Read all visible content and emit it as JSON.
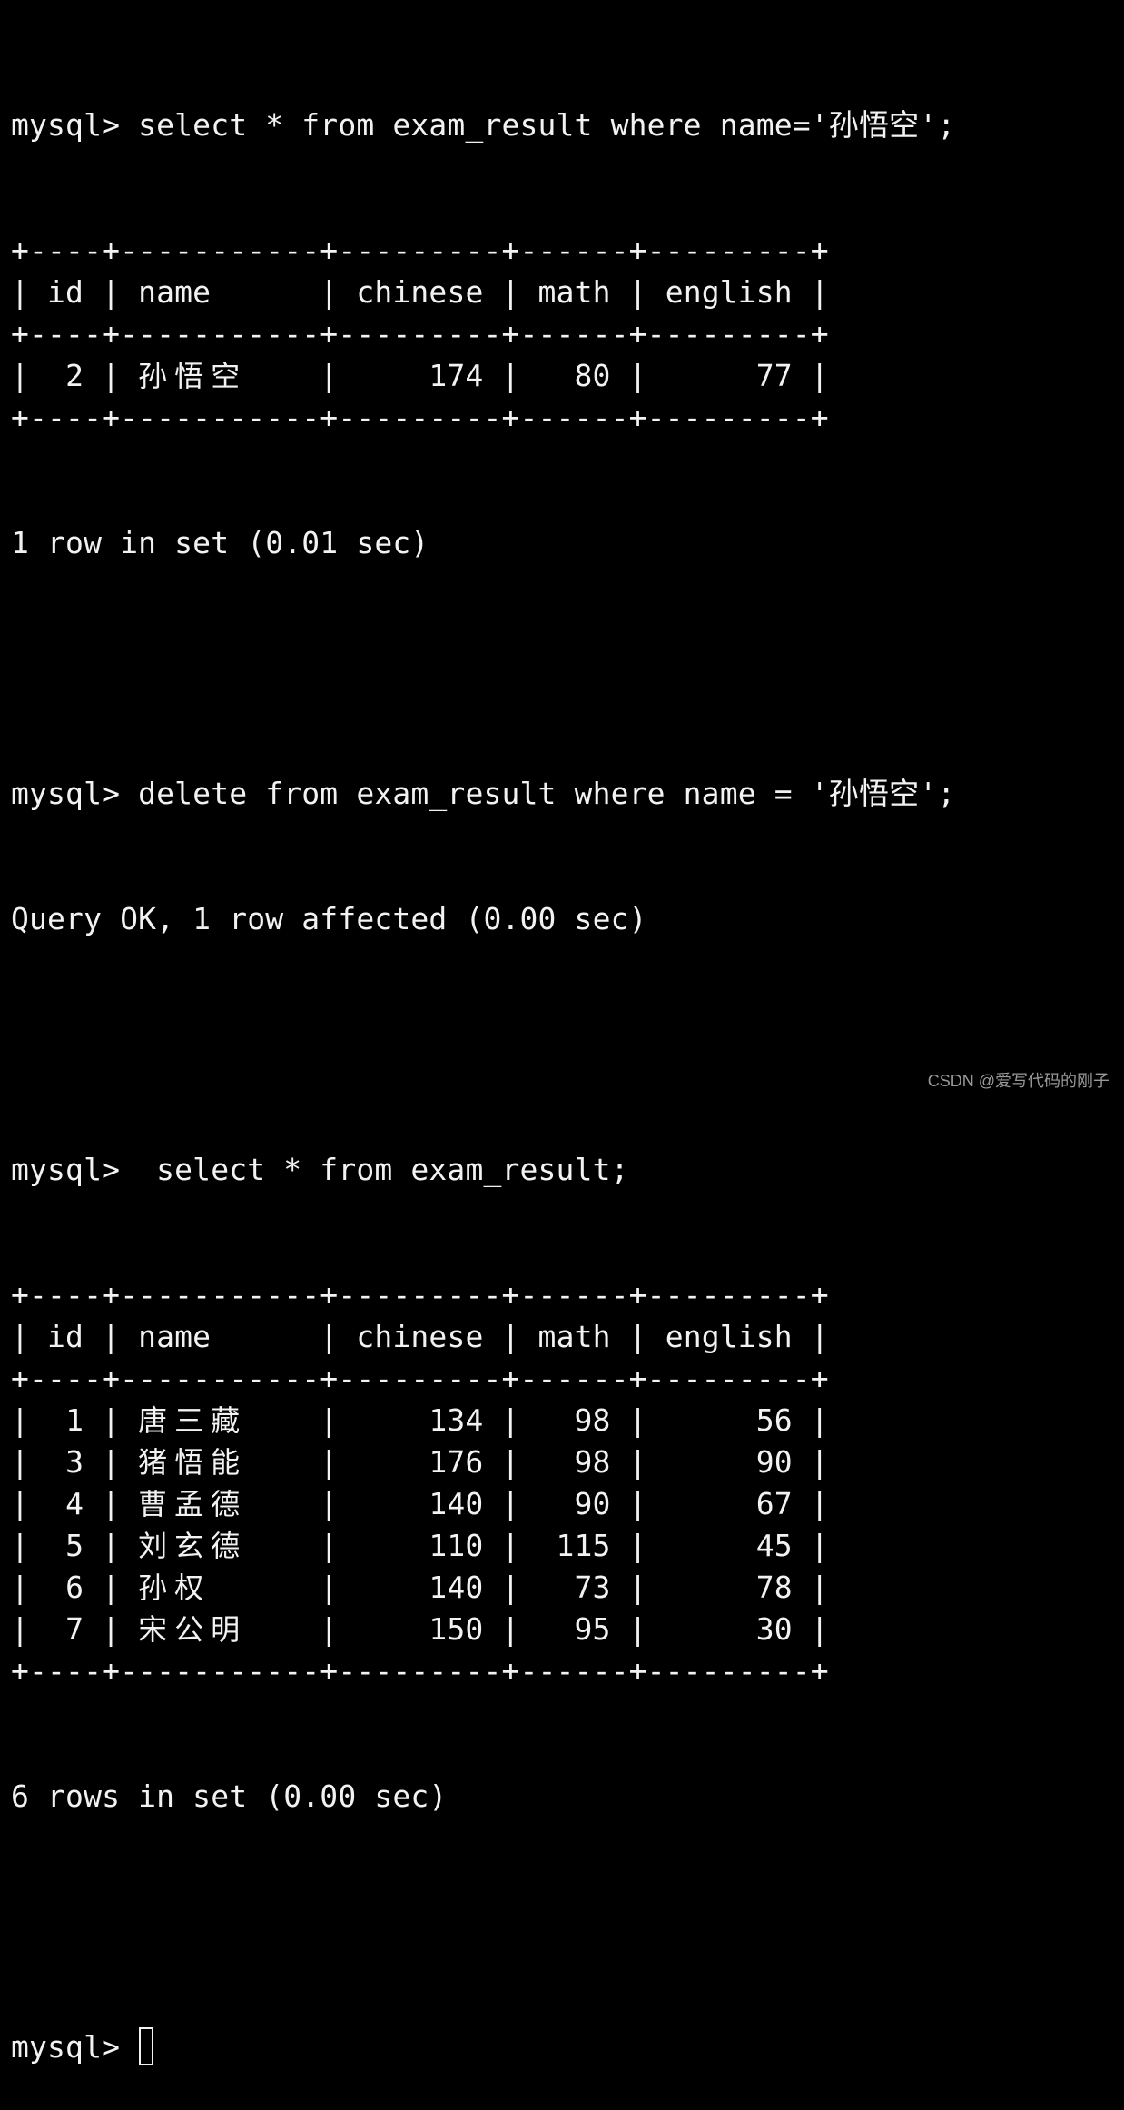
{
  "terminal": {
    "prompt": "mysql> ",
    "commands": [
      "select * from exam_result where name='孙悟空';",
      "delete from exam_result where name = '孙悟空';",
      " select * from exam_result;"
    ],
    "results": {
      "query1_status": "1 row in set (0.01 sec)",
      "delete_status": "Query OK, 1 row affected (0.00 sec)",
      "query2_status": "6 rows in set (0.00 sec)"
    },
    "table": {
      "border": "+----+-----------+---------+------+---------+",
      "columns": [
        "id",
        "name",
        "chinese",
        "math",
        "english"
      ]
    },
    "query1_rows": [
      {
        "id": "2",
        "name": "孙悟空",
        "chinese": "174",
        "math": "80",
        "english": "77"
      }
    ],
    "query2_rows": [
      {
        "id": "1",
        "name": "唐三藏",
        "chinese": "134",
        "math": "98",
        "english": "56"
      },
      {
        "id": "3",
        "name": "猪悟能",
        "chinese": "176",
        "math": "98",
        "english": "90"
      },
      {
        "id": "4",
        "name": "曹孟德",
        "chinese": "140",
        "math": "90",
        "english": "67"
      },
      {
        "id": "5",
        "name": "刘玄德",
        "chinese": "110",
        "math": "115",
        "english": "45"
      },
      {
        "id": "6",
        "name": "孙权",
        "chinese": "140",
        "math": "73",
        "english": "78"
      },
      {
        "id": "7",
        "name": "宋公明",
        "chinese": "150",
        "math": "95",
        "english": "30"
      }
    ]
  },
  "watermark": "CSDN @爱写代码的刚子"
}
